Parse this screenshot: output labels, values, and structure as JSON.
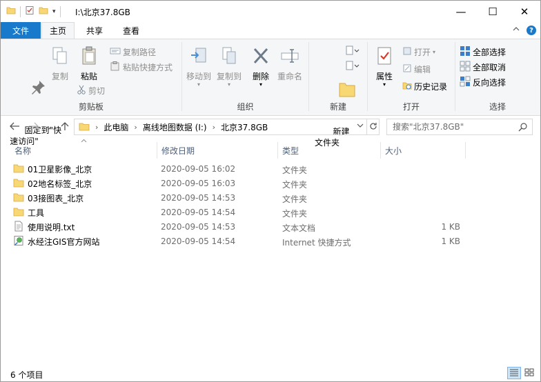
{
  "window": {
    "title": "I:\\北京37.8GB",
    "controls": {
      "minimize": "—",
      "maximize": "☐",
      "close": "✕"
    }
  },
  "tabs": {
    "file": "文件",
    "items": [
      {
        "label": "主页",
        "active": true
      },
      {
        "label": "共享",
        "active": false
      },
      {
        "label": "查看",
        "active": false
      }
    ],
    "collapse_icon": "chevron-up-icon",
    "help_label": "?"
  },
  "ribbon": {
    "clipboard": {
      "label": "剪贴板",
      "pin": "固定到\"快\n速访问\"",
      "copy": "复制",
      "paste": "粘贴",
      "copy_path": "复制路径",
      "paste_shortcut": "粘贴快捷方式",
      "cut": "剪切"
    },
    "organize": {
      "label": "组织",
      "move_to": "移动到",
      "copy_to": "复制到",
      "delete": "删除",
      "rename": "重命名"
    },
    "new": {
      "label": "新建",
      "new_folder": "新建\n文件夹"
    },
    "open": {
      "label": "打开",
      "properties": "属性",
      "open": "打开",
      "edit": "编辑",
      "history": "历史记录"
    },
    "select": {
      "label": "选择",
      "select_all": "全部选择",
      "select_none": "全部取消",
      "invert": "反向选择"
    }
  },
  "address": {
    "crumbs": [
      "此电脑",
      "离线地图数据 (I:)",
      "北京37.8GB"
    ],
    "search_placeholder": "搜索\"北京37.8GB\""
  },
  "columns": {
    "name": "名称",
    "date": "修改日期",
    "type": "类型",
    "size": "大小"
  },
  "files": [
    {
      "name": "01卫星影像_北京",
      "date": "2020-09-05 16:02",
      "type": "文件夹",
      "size": "",
      "icon": "folder-icon"
    },
    {
      "name": "02地名标签_北京",
      "date": "2020-09-05 16:03",
      "type": "文件夹",
      "size": "",
      "icon": "folder-icon"
    },
    {
      "name": "03接图表_北京",
      "date": "2020-09-05 14:53",
      "type": "文件夹",
      "size": "",
      "icon": "folder-icon"
    },
    {
      "name": "工具",
      "date": "2020-09-05 14:54",
      "type": "文件夹",
      "size": "",
      "icon": "folder-icon"
    },
    {
      "name": "使用说明.txt",
      "date": "2020-09-05 14:53",
      "type": "文本文档",
      "size": "1 KB",
      "icon": "text-file-icon"
    },
    {
      "name": "水经注GIS官方网站",
      "date": "2020-09-05 14:54",
      "type": "Internet 快捷方式",
      "size": "1 KB",
      "icon": "internet-shortcut-icon"
    }
  ],
  "status": {
    "count": "6 个项目"
  },
  "colors": {
    "accent": "#1979ca",
    "folder": "#f8d775",
    "ribbon_bg": "#f5f6f7",
    "header_text": "#4c607a"
  }
}
